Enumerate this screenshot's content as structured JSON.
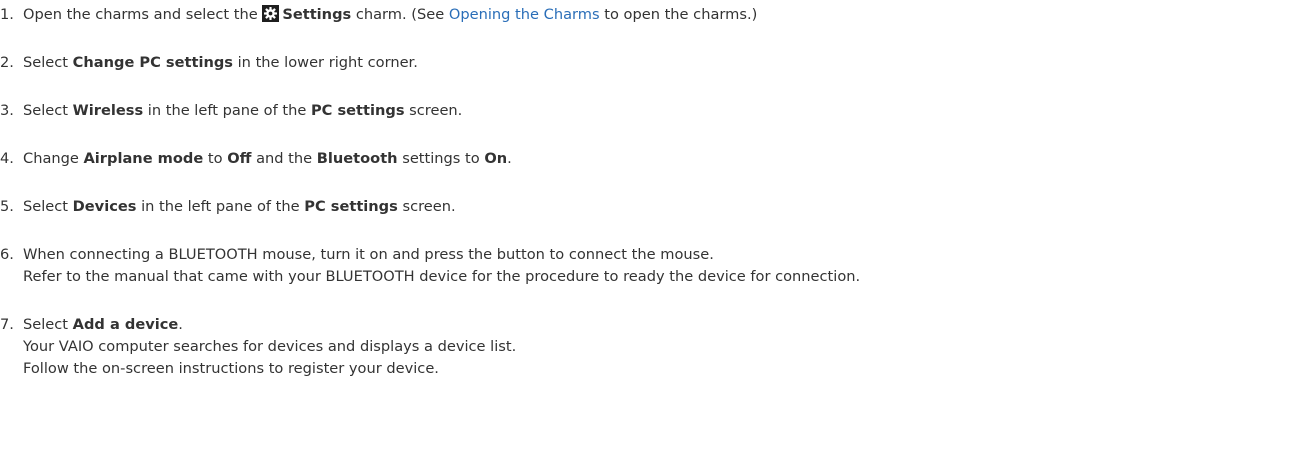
{
  "steps": [
    {
      "num": "1.",
      "pre": "Open the charms and select the ",
      "settings_label": "Settings",
      "mid": " charm. (See ",
      "link": "Opening the Charms",
      "post": " to open the charms.)"
    },
    {
      "num": "2.",
      "a": "Select ",
      "b1": "Change PC settings",
      "c": " in the lower right corner."
    },
    {
      "num": "3.",
      "a": "Select ",
      "b1": "Wireless",
      "c": " in the left pane of the ",
      "b2": "PC settings",
      "d": " screen."
    },
    {
      "num": "4.",
      "a": "Change ",
      "b1": "Airplane mode",
      "c": " to ",
      "b2": "Off",
      "d": " and the ",
      "b3": "Bluetooth",
      "e": " settings to ",
      "b4": "On",
      "f": "."
    },
    {
      "num": "5.",
      "a": "Select ",
      "b1": "Devices",
      "c": " in the left pane of the ",
      "b2": "PC settings",
      "d": " screen."
    },
    {
      "num": "6.",
      "line1": "When connecting a BLUETOOTH mouse, turn it on and press the button to connect the mouse.",
      "line2": "Refer to the manual that came with your BLUETOOTH device for the procedure to ready the device for connection."
    },
    {
      "num": "7.",
      "a": "Select ",
      "b1": "Add a device",
      "c": ".",
      "line2": "Your VAIO computer searches for devices and displays a device list.",
      "line3": "Follow the on-screen instructions to register your device."
    }
  ],
  "icons": {
    "settings": "gear-icon"
  },
  "colors": {
    "text": "#333333",
    "link": "#2a6eb8",
    "icon_bg": "#1e1e1e"
  }
}
